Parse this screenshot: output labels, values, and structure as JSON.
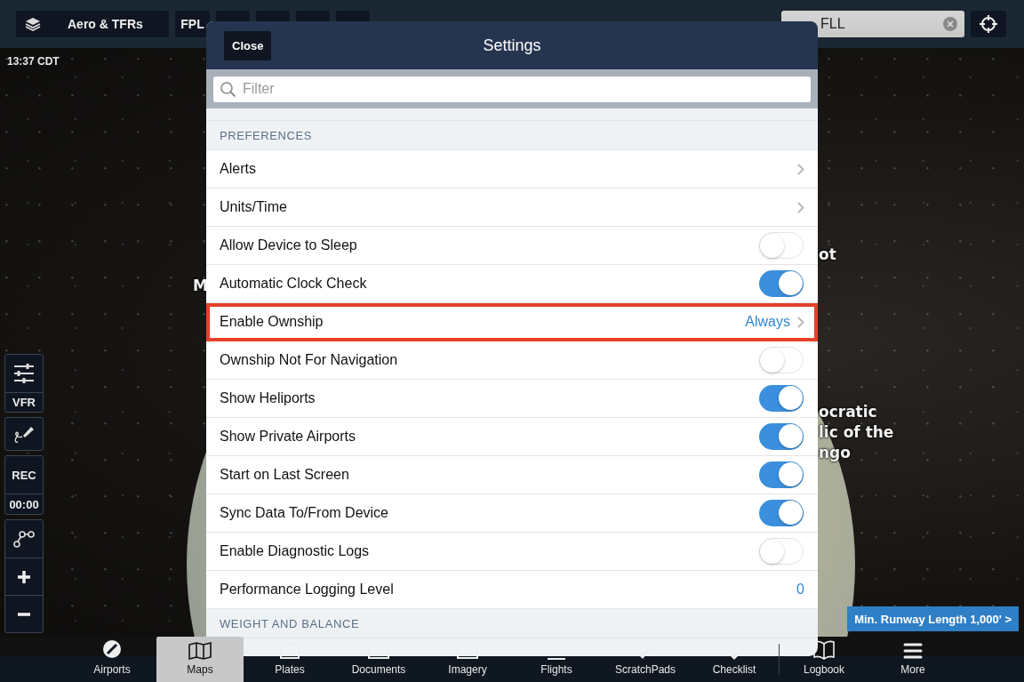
{
  "top_bar": {
    "layers_button": "Aero & TFRs",
    "fpl_button": "FPL",
    "search": {
      "value": "FLL"
    }
  },
  "clock": "13:37 CDT",
  "map_labels": [
    {
      "lines": [
        "M"
      ]
    },
    {
      "lines": [
        "ot"
      ]
    },
    {
      "lines": [
        "ocratic",
        "lic of the",
        "ngo"
      ]
    }
  ],
  "map_tools": {
    "map_mode": "VFR",
    "record": "REC",
    "timer": "00:00"
  },
  "runway_button": "Min. Runway Length 1,000' >",
  "settings": {
    "close": "Close",
    "title": "Settings",
    "filter": {
      "placeholder": "Filter"
    },
    "sections": [
      {
        "header": "PREFERENCES",
        "rows": [
          {
            "kind": "link",
            "label": "Alerts",
            "highlighted": false
          },
          {
            "kind": "link",
            "label": "Units/Time",
            "highlighted": false
          },
          {
            "kind": "toggle",
            "label": "Allow Device to Sleep",
            "on": false,
            "highlighted": false
          },
          {
            "kind": "toggle",
            "label": "Automatic Clock Check",
            "on": true,
            "highlighted": false
          },
          {
            "kind": "link",
            "label": "Enable Ownship",
            "value": "Always",
            "highlighted": true
          },
          {
            "kind": "toggle",
            "label": "Ownship Not For Navigation",
            "on": false,
            "highlighted": false
          },
          {
            "kind": "toggle",
            "label": "Show Heliports",
            "on": true,
            "highlighted": false
          },
          {
            "kind": "toggle",
            "label": "Show Private Airports",
            "on": true,
            "highlighted": false
          },
          {
            "kind": "toggle",
            "label": "Start on Last Screen",
            "on": true,
            "highlighted": false
          },
          {
            "kind": "toggle",
            "label": "Sync Data To/From Device",
            "on": true,
            "highlighted": false
          },
          {
            "kind": "toggle",
            "label": "Enable Diagnostic Logs",
            "on": false,
            "highlighted": false
          },
          {
            "kind": "value",
            "label": "Performance Logging Level",
            "value": "0",
            "highlighted": false
          }
        ]
      },
      {
        "header": "WEIGHT AND BALANCE"
      }
    ]
  },
  "tabs": [
    {
      "kind": "airports",
      "label": "Airports",
      "selected": false
    },
    {
      "kind": "maps",
      "label": "Maps",
      "selected": true
    },
    {
      "kind": "plates",
      "label": "Plates",
      "selected": false
    },
    {
      "kind": "documents",
      "label": "Documents",
      "selected": false
    },
    {
      "kind": "imagery",
      "label": "Imagery",
      "selected": false
    },
    {
      "kind": "flights",
      "label": "Flights",
      "selected": false
    },
    {
      "kind": "scratchpads",
      "label": "ScratchPads",
      "selected": false
    },
    {
      "kind": "checklist",
      "label": "Checklist",
      "selected": false
    },
    {
      "kind": "logbook",
      "label": "Logbook",
      "selected": false
    },
    {
      "kind": "more",
      "label": "More",
      "selected": false
    }
  ]
}
